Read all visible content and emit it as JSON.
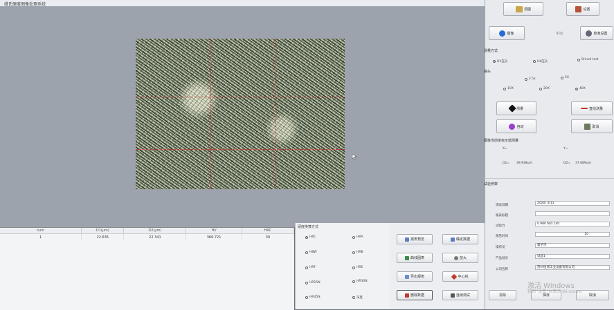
{
  "window": {
    "title": "维氏硬度图像处理系统"
  },
  "table": {
    "headers": [
      "num",
      "D1(μm)",
      "D2(μm)",
      "HV",
      "HRC"
    ],
    "rows": [
      [
        "1",
        "22.635",
        "22.341",
        "366.721",
        "39"
      ]
    ]
  },
  "conversion": {
    "title": "硬度换算方式",
    "options": [
      {
        "label": "HRC",
        "selected": true
      },
      {
        "label": "HRA",
        "selected": false
      },
      {
        "label": "HBW",
        "selected": false
      },
      {
        "label": "HRB",
        "selected": false
      },
      {
        "label": "HRF",
        "selected": false
      },
      {
        "label": "HRE",
        "selected": false
      },
      {
        "label": "HR15N",
        "selected": false
      },
      {
        "label": "HR30N",
        "selected": false
      },
      {
        "label": "HR45N",
        "selected": false
      },
      {
        "label": "深度",
        "selected": false
      }
    ]
  },
  "actions": {
    "save_report": "报表预览",
    "confirm_data": "确定数据",
    "draw_chart": "曲线图表",
    "zoom": "放大",
    "export": "导出报表",
    "center_line": "中心线",
    "delete": "删除数据",
    "continuous": "连续测试"
  },
  "panel": {
    "load": "调图",
    "settings": "设置",
    "capture": "摄像",
    "mode_label": "手动",
    "calib": "校准设置",
    "measure_mode_title": "测量方式",
    "measure_modes": [
      {
        "label": "HV压头",
        "selected": true
      },
      {
        "label": "HK压头",
        "selected": false
      },
      {
        "label": "Brinell test",
        "selected": false
      }
    ],
    "lens_title": "镜头",
    "lens_row1": [
      {
        "label": "2.5x",
        "selected": false
      },
      {
        "label": "5X",
        "selected": false
      }
    ],
    "lens_row2": [
      {
        "label": "10X",
        "selected": false
      },
      {
        "label": "20X",
        "selected": false
      },
      {
        "label": "40X",
        "selected": true
      }
    ],
    "measure_btn": "测量",
    "line_measure_btn": "直线测量",
    "auto_btn": "自动",
    "cancel_btn": "取消",
    "result_title": "图像当前坐标示值测量",
    "x_label": "X=",
    "y_label": "Y=",
    "d1_label": "D1=",
    "d1_value": "39.938um",
    "d2_label": "D2=",
    "d2_value": "37.689um",
    "info_title": "试验参数",
    "fields": [
      {
        "label": "测试日期",
        "value": "2020/ 3/11"
      },
      {
        "label": "报表标题",
        "value": ""
      },
      {
        "label": "试验力",
        "value": "0.980 N(0.1kf)"
      },
      {
        "label": "保压时间",
        "value": "10"
      },
      {
        "label": "操作员",
        "value": "量子杰"
      },
      {
        "label": "产品批号",
        "value": "试品1"
      },
      {
        "label": "公司名称",
        "value": "苏州恒测工业设备有限公司"
      }
    ],
    "clear_btn": "清除",
    "save_btn": "保存",
    "exit_btn": "取消"
  },
  "watermark": {
    "line1": "激活 Windows",
    "line2": "转到“设置”以激活 Windows。"
  }
}
